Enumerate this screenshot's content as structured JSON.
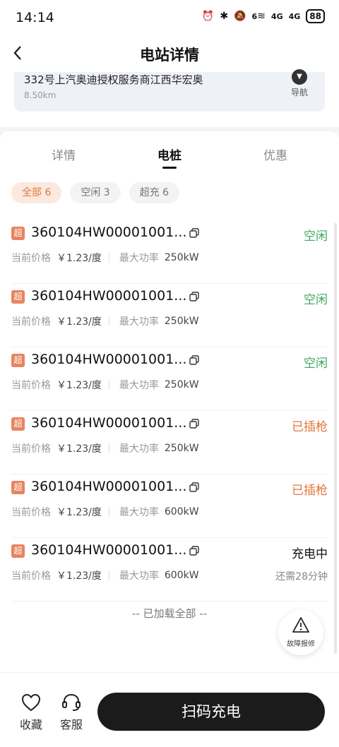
{
  "status_bar": {
    "time": "14:14",
    "battery": "88",
    "sig1": "4G",
    "sig2": "4G",
    "wifi_num": "6"
  },
  "header": {
    "title": "电站详情"
  },
  "station": {
    "name": "332号上汽奥迪授权服务商江西华宏奥",
    "distance": "8.50km",
    "nav_label": "导航"
  },
  "tabs": [
    {
      "label": "详情"
    },
    {
      "label": "电桩"
    },
    {
      "label": "优惠"
    }
  ],
  "filters": [
    {
      "label": "全部 6"
    },
    {
      "label": "空闲 3"
    },
    {
      "label": "超充 6"
    }
  ],
  "labels": {
    "price": "当前价格",
    "power": "最大功率",
    "badge": "超"
  },
  "piles": [
    {
      "id": "360104HW00001001...",
      "status": "空闲",
      "price": "￥1.23/度",
      "power": "250kW",
      "remain": ""
    },
    {
      "id": "360104HW00001001...",
      "status": "空闲",
      "price": "￥1.23/度",
      "power": "250kW",
      "remain": ""
    },
    {
      "id": "360104HW00001001...",
      "status": "空闲",
      "price": "￥1.23/度",
      "power": "250kW",
      "remain": ""
    },
    {
      "id": "360104HW00001001...",
      "status": "已插枪",
      "price": "￥1.23/度",
      "power": "250kW",
      "remain": ""
    },
    {
      "id": "360104HW00001001...",
      "status": "已插枪",
      "price": "￥1.23/度",
      "power": "600kW",
      "remain": ""
    },
    {
      "id": "360104HW00001001...",
      "status": "充电中",
      "price": "￥1.23/度",
      "power": "600kW",
      "remain": "还需28分钟"
    }
  ],
  "list_end": "-- 已加载全部 --",
  "fault": {
    "label": "故障报修"
  },
  "bottom": {
    "favorite": "收藏",
    "service": "客服",
    "scan": "扫码充电"
  },
  "colors": {
    "free": "#3fa45b",
    "plugged": "#e0783a",
    "accent": "#e0783a"
  }
}
